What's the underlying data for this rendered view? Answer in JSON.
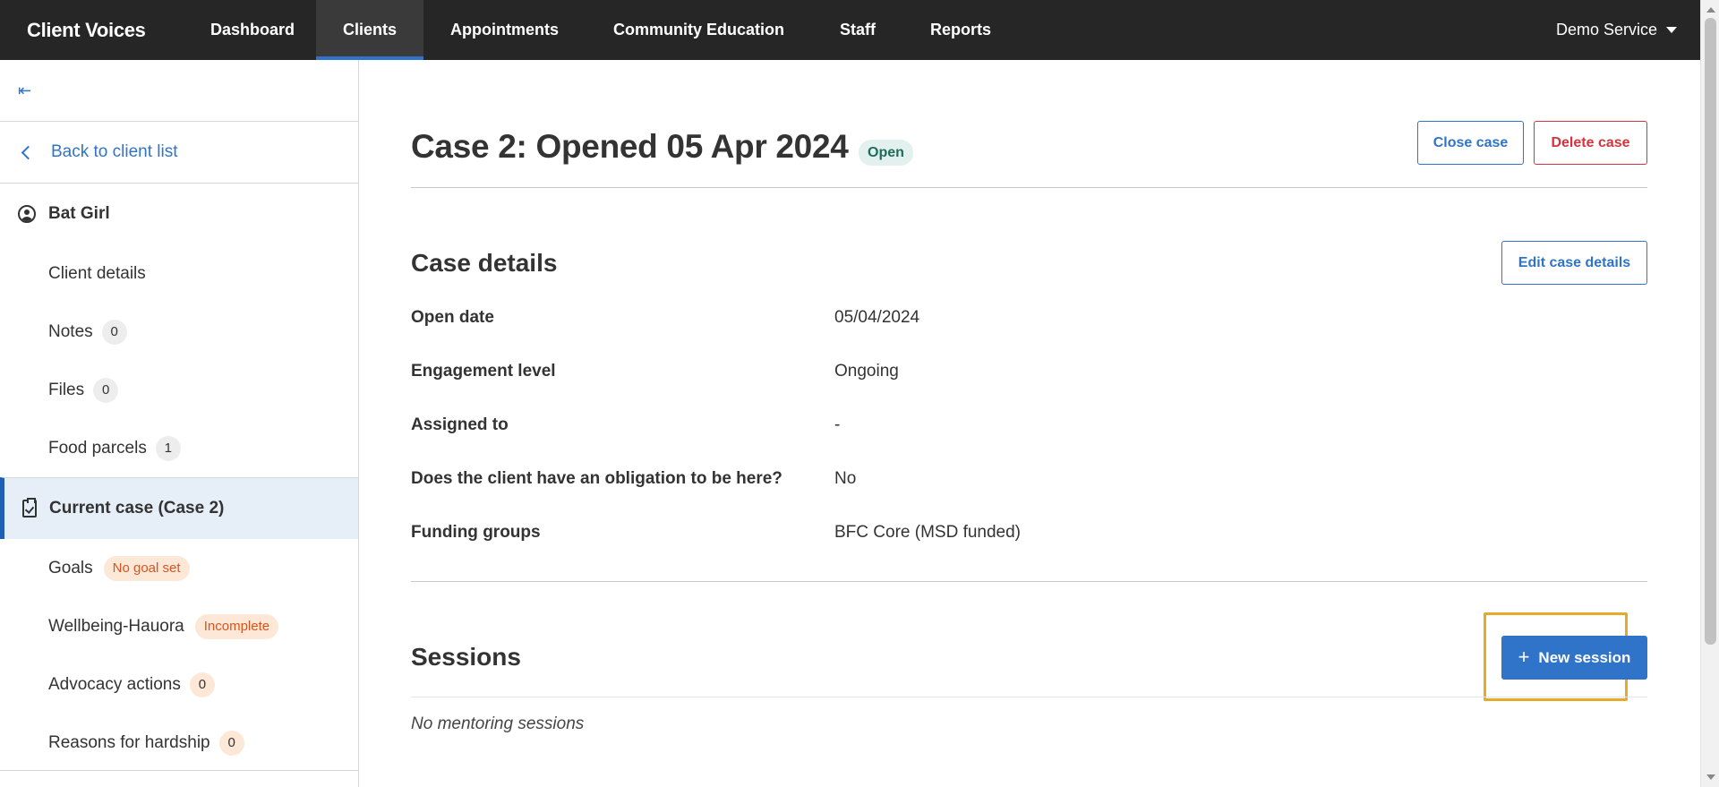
{
  "nav": {
    "brand": "Client Voices",
    "items": [
      {
        "label": "Dashboard",
        "notify": true
      },
      {
        "label": "Clients",
        "active": true
      },
      {
        "label": "Appointments"
      },
      {
        "label": "Community Education"
      },
      {
        "label": "Staff"
      },
      {
        "label": "Reports"
      }
    ],
    "service": "Demo Service"
  },
  "sidebar": {
    "collapse_glyph": "⇤",
    "back_label": "Back to client list",
    "client_name": "Bat Girl",
    "client_items": [
      {
        "label": "Client details"
      },
      {
        "label": "Notes",
        "count": "0"
      },
      {
        "label": "Files",
        "count": "0"
      },
      {
        "label": "Food parcels",
        "count": "1"
      }
    ],
    "current_case": "Current case (Case 2)",
    "case_items": [
      {
        "label": "Goals",
        "tag": "No goal set"
      },
      {
        "label": "Wellbeing-Hauora",
        "tag": "Incomplete"
      },
      {
        "label": "Advocacy actions",
        "count": "0"
      },
      {
        "label": "Reasons for hardship",
        "count": "0"
      }
    ]
  },
  "case": {
    "title": "Case 2: Opened 05 Apr 2024",
    "status": "Open",
    "close_label": "Close case",
    "delete_label": "Delete case"
  },
  "details": {
    "title": "Case details",
    "edit_label": "Edit case details",
    "rows": [
      {
        "label": "Open date",
        "value": "05/04/2024"
      },
      {
        "label": "Engagement level",
        "value": "Ongoing"
      },
      {
        "label": "Assigned to",
        "value": "-"
      },
      {
        "label": "Does the client have an obligation to be here?",
        "value": "No"
      },
      {
        "label": "Funding groups",
        "value": "BFC Core (MSD funded)"
      }
    ]
  },
  "sessions": {
    "title": "Sessions",
    "new_label": "New session",
    "plus_glyph": "+",
    "empty": "No mentoring sessions"
  },
  "colors": {
    "nav_bg": "#262626",
    "accent": "#2f74c9",
    "danger": "#d6343c",
    "notify": "#ee6a1e",
    "highlight": "#e6a92a"
  }
}
